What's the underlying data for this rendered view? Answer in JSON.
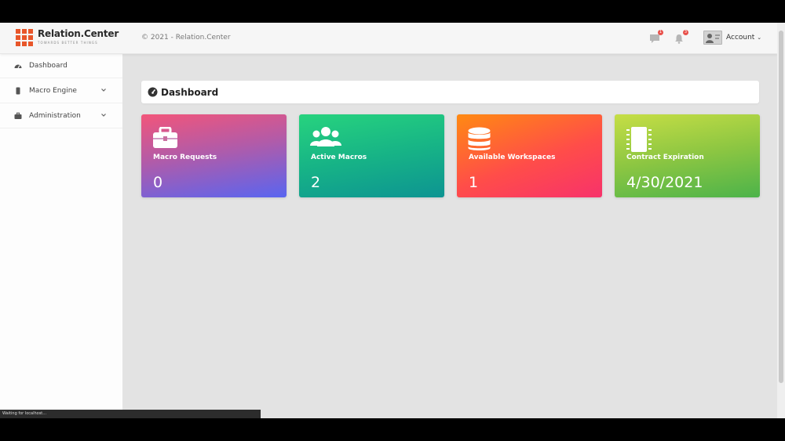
{
  "header": {
    "brand_name": "Relation.Center",
    "brand_tagline": "TOWARDS BETTER THINGS",
    "copyright": "© 2021 - Relation.Center",
    "messages_badge": "1",
    "notifications_badge": "3",
    "account_label": "Account"
  },
  "sidebar": {
    "items": [
      {
        "label": "Dashboard",
        "icon": "tachometer-icon"
      },
      {
        "label": "Macro Engine",
        "icon": "mobile-icon"
      },
      {
        "label": "Administration",
        "icon": "briefcase-icon"
      }
    ]
  },
  "main": {
    "title": "Dashboard",
    "cards": [
      {
        "label": "Macro Requests",
        "value": "0",
        "icon": "briefcase-icon"
      },
      {
        "label": "Active Macros",
        "value": "2",
        "icon": "users-icon"
      },
      {
        "label": "Available Workspaces",
        "value": "1",
        "icon": "database-icon"
      },
      {
        "label": "Contract Expiration",
        "value": "4/30/2021",
        "icon": "microchip-icon"
      }
    ]
  },
  "status_bar": {
    "text": "Waiting for localhost..."
  },
  "colors": {
    "brand_accent": "#e8562a",
    "badge": "#e8504a",
    "card_macro_requests": [
      "#f2557a",
      "#5965f0"
    ],
    "card_active_macros": [
      "#27d37e",
      "#0d9492"
    ],
    "card_available_workspaces": [
      "#ff8a12",
      "#f7326b"
    ],
    "card_contract_expiration": [
      "#c6de45",
      "#4cb34a"
    ]
  }
}
